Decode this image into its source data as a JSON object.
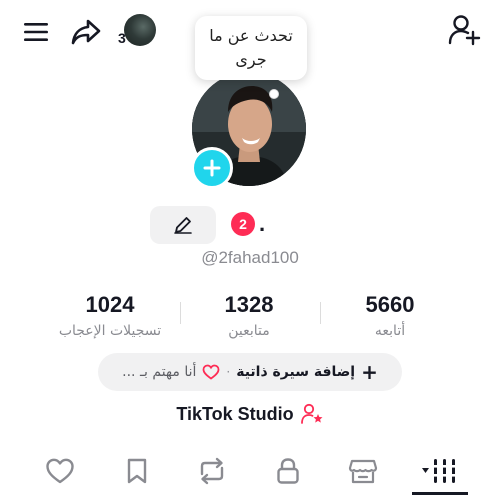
{
  "header": {
    "story_count": "3",
    "tooltip_line1": "تحدث عن ما",
    "tooltip_line2": "جرى"
  },
  "profile": {
    "notification_count": "2",
    "display_name": ".",
    "username": "@2fahad100"
  },
  "stats": [
    {
      "value": "1024",
      "label": "تسجيلات الإعجاب"
    },
    {
      "value": "1328",
      "label": "متابعين"
    },
    {
      "value": "5660",
      "label": "أتابعه"
    }
  ],
  "bio": {
    "add_bio": "إضافة سيرة ذاتية",
    "separator": "·",
    "interests": "أنا مهتم بـ ..."
  },
  "studio": {
    "label": "TikTok Studio"
  },
  "colors": {
    "accent": "#fe2c55",
    "cyan": "#20d5ec",
    "text": "#161823",
    "muted": "#8a8b91"
  },
  "tabs": [
    {
      "icon": "grid-icon",
      "active": true
    },
    {
      "icon": "shop-icon"
    },
    {
      "icon": "lock-icon"
    },
    {
      "icon": "repost-icon"
    },
    {
      "icon": "bookmark-icon"
    },
    {
      "icon": "heart-icon"
    }
  ]
}
